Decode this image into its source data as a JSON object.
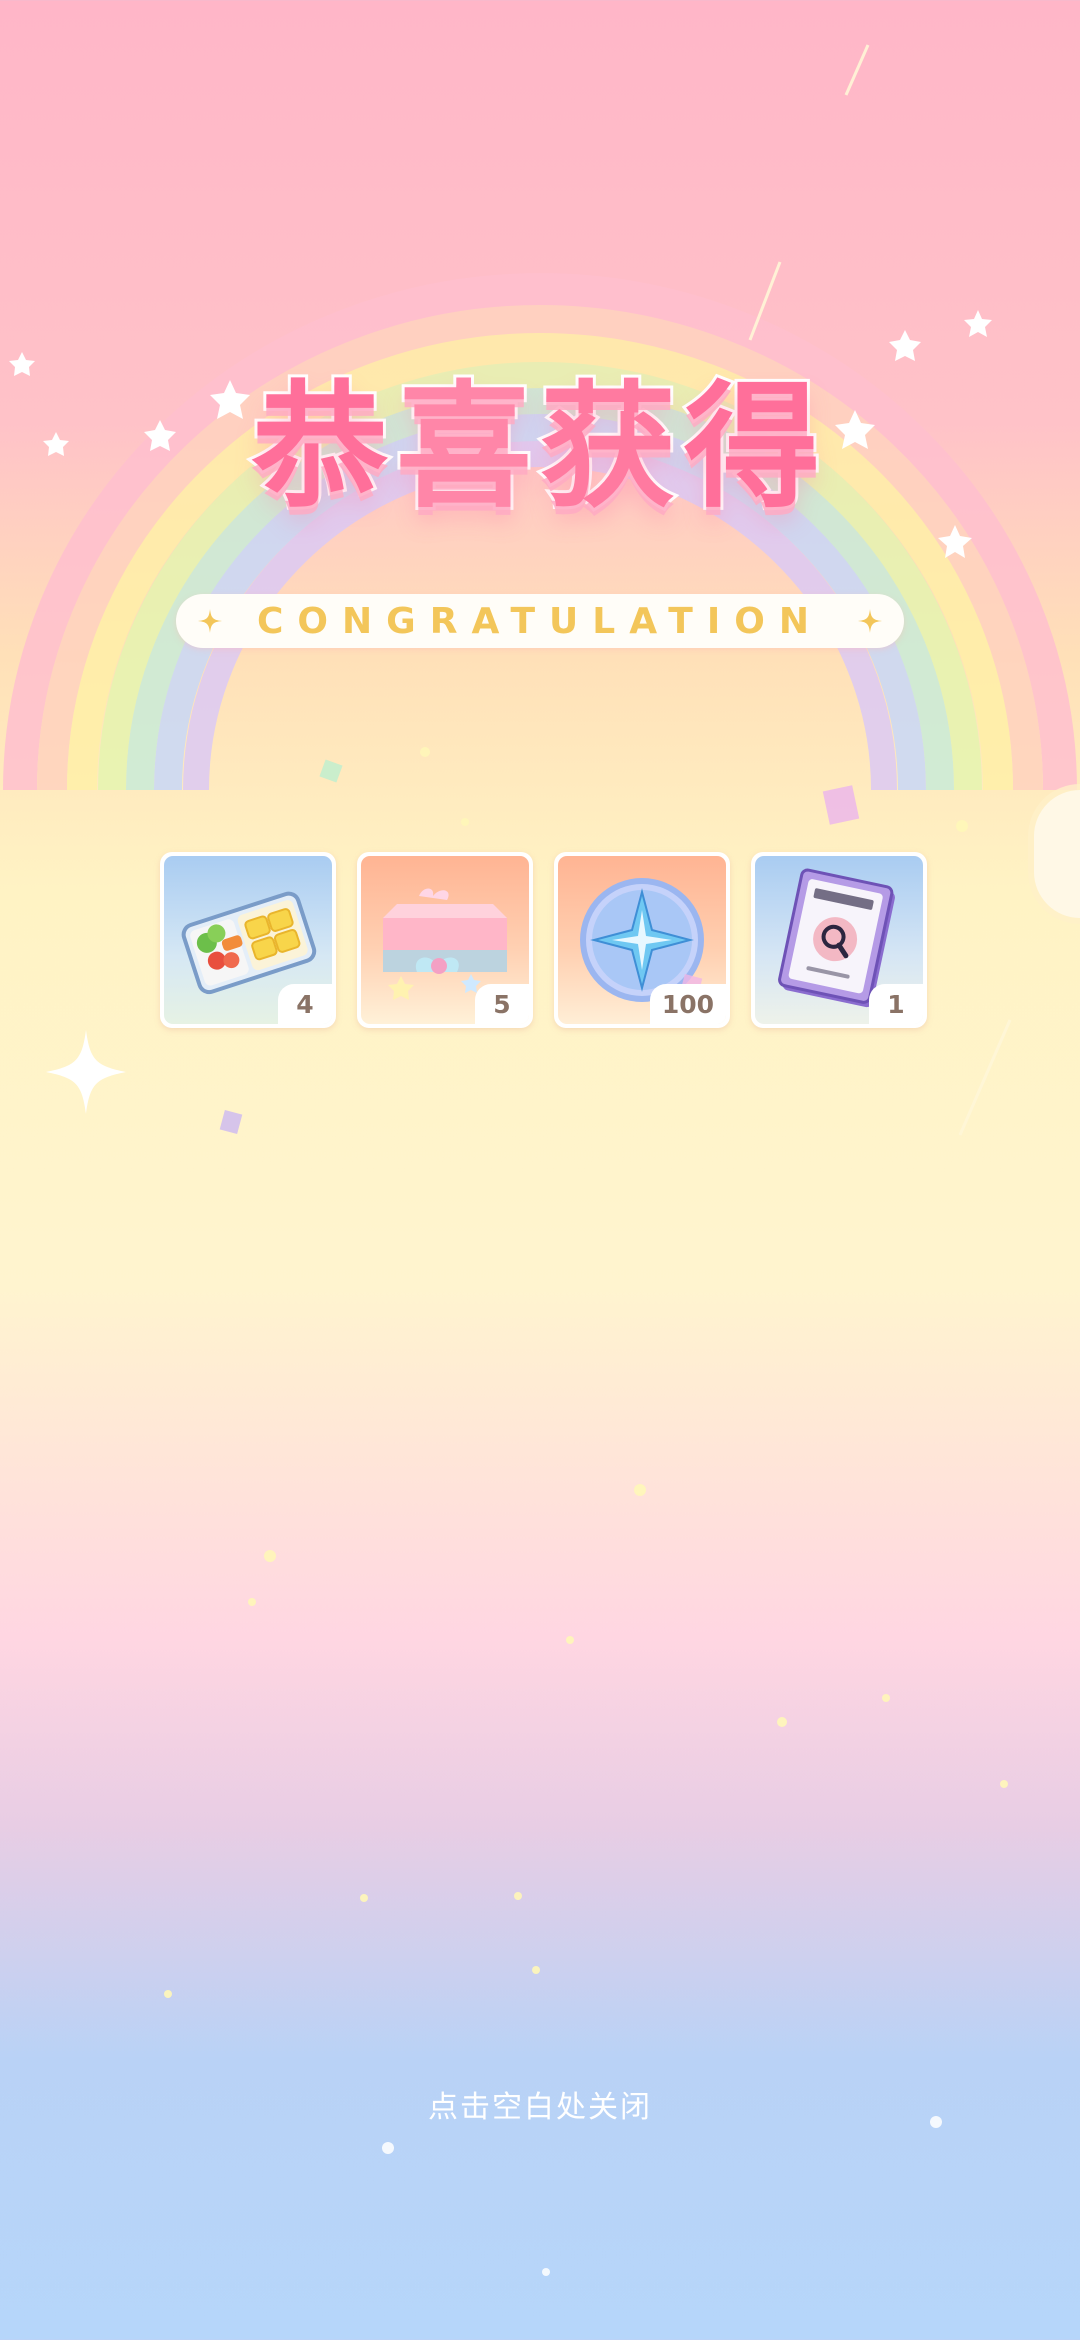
{
  "title": {
    "chars": [
      "恭",
      "喜",
      "获",
      "得"
    ],
    "subtitle": "CONGRATULATION"
  },
  "rewards": [
    {
      "icon": "bento-box-icon",
      "quantity": "4"
    },
    {
      "icon": "gift-box-icon",
      "quantity": "5"
    },
    {
      "icon": "compass-coin-icon",
      "quantity": "100"
    },
    {
      "icon": "magnifier-book-icon",
      "quantity": "1"
    }
  ],
  "close_hint": "点击空白处关闭",
  "colors": {
    "title_pink": "#ff6f9a",
    "subtitle_gold": "#f3c65a",
    "qty_text": "#8a7366"
  }
}
